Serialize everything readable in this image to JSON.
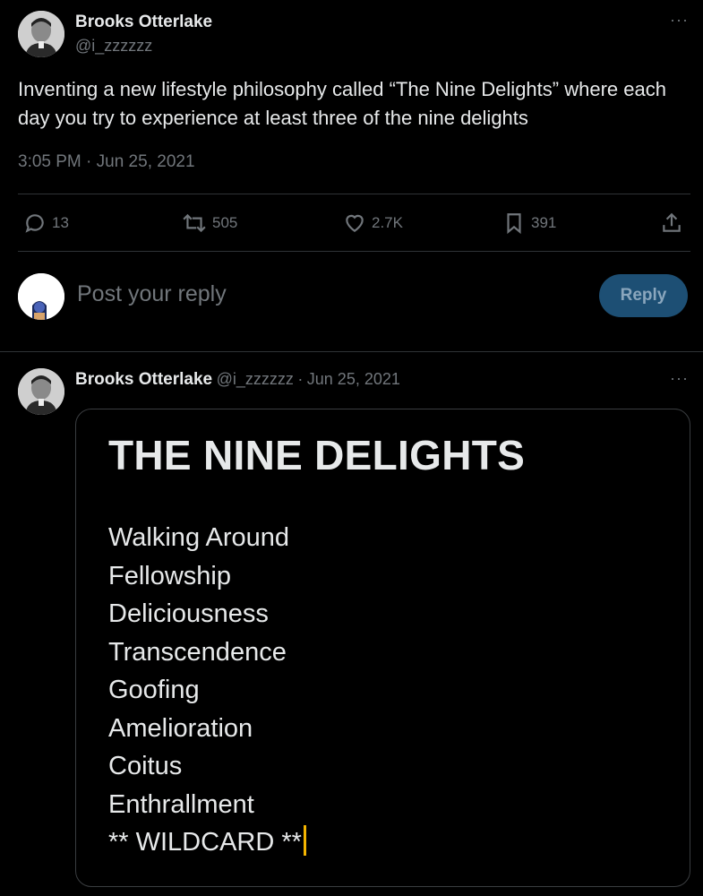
{
  "main_tweet": {
    "author_name": "Brooks Otterlake",
    "author_handle": "@i_zzzzzz",
    "more_label": "···",
    "text": "Inventing a new lifestyle philosophy called “The Nine Delights” where each day you try to experience at least three of the nine delights",
    "timestamp": "3:05 PM · Jun 25, 2021",
    "actions": {
      "reply_count": "13",
      "retweet_count": "505",
      "like_count": "2.7K",
      "bookmark_count": "391"
    }
  },
  "reply_composer": {
    "placeholder": "Post your reply",
    "button_label": "Reply"
  },
  "reply_tweet": {
    "author_name": "Brooks Otterlake",
    "author_handle": "@i_zzzzzz",
    "separator": "·",
    "date": "Jun 25, 2021",
    "more_label": "···",
    "card": {
      "title": "THE NINE DELIGHTS",
      "items": [
        "Walking Around",
        "Fellowship",
        "Deliciousness",
        "Transcendence",
        "Goofing",
        "Amelioration",
        "Coitus",
        "Enthrallment",
        "** WILDCARD **"
      ]
    }
  },
  "colors": {
    "background": "#000000",
    "text_primary": "#e7e9ea",
    "text_secondary": "#71767b",
    "divider": "#2f3336",
    "reply_button": "#1d4f74",
    "cursor": "#f4b400"
  }
}
